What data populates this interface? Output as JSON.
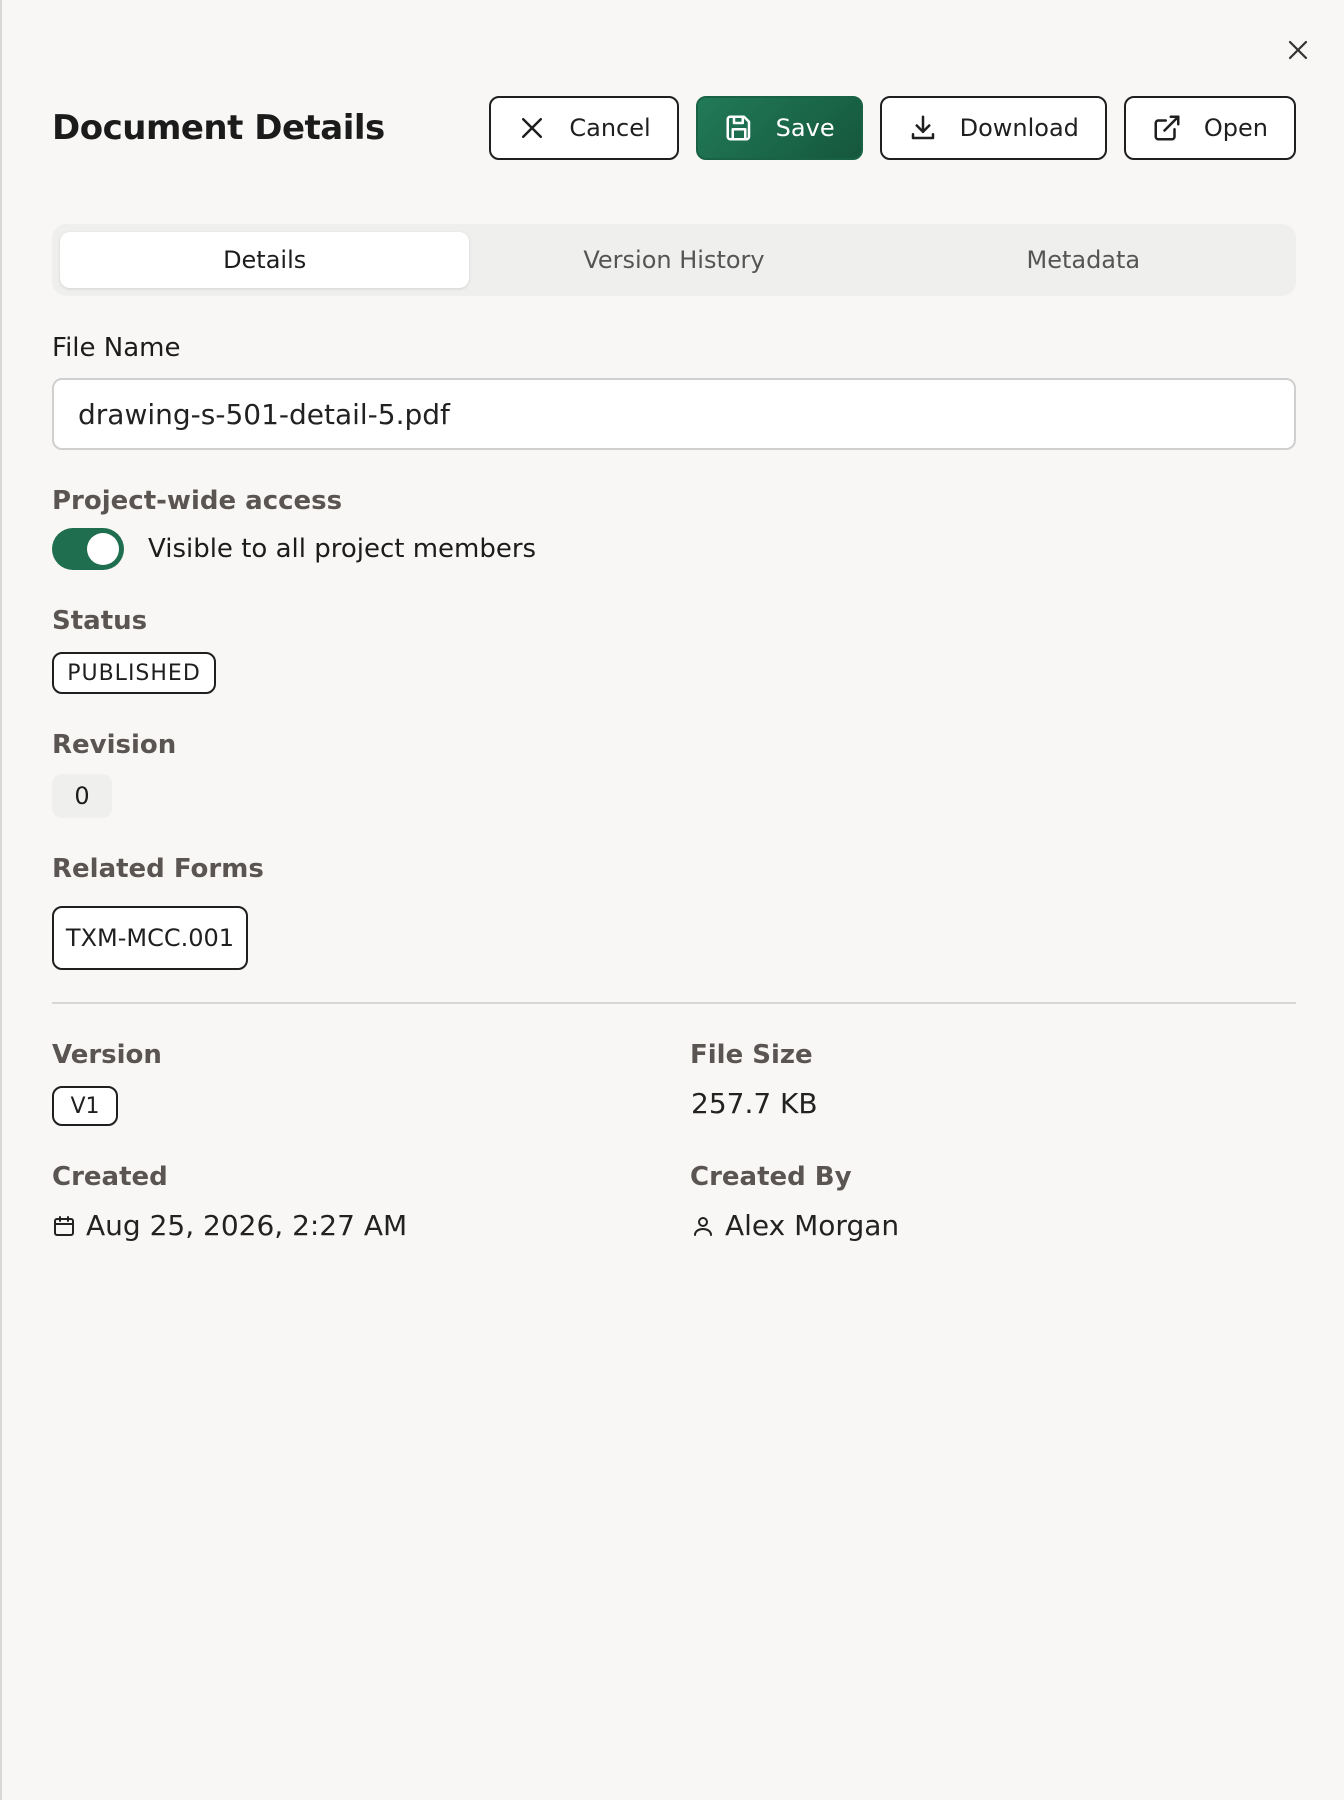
{
  "dialog": {
    "title": "Document Details",
    "actions": {
      "cancel_label": "Cancel",
      "save_label": "Save",
      "download_label": "Download",
      "open_label": "Open"
    },
    "close_icon": "close-icon"
  },
  "tabs": [
    {
      "label": "Details",
      "active": true
    },
    {
      "label": "Version History",
      "active": false
    },
    {
      "label": "Metadata",
      "active": false
    }
  ],
  "form": {
    "file_name_label": "File Name",
    "file_name_value": "drawing-s-501-detail-5.pdf",
    "access_label": "Project-wide access",
    "access_toggle_on": true,
    "access_toggle_text": "Visible to all project members",
    "status_label": "Status",
    "status_value": "PUBLISHED",
    "revision_label": "Revision",
    "revision_value": "0",
    "related_forms_label": "Related Forms",
    "related_forms": [
      "TXM-MCC.001"
    ]
  },
  "info": {
    "version_label": "Version",
    "version_value": "V1",
    "file_size_label": "File Size",
    "file_size_value": "257.7 KB",
    "created_label": "Created",
    "created_value": "Aug 25, 2026, 2:27 AM",
    "created_by_label": "Created By",
    "created_by_value": "Alex Morgan"
  },
  "colors": {
    "accent": "#1e6e4f",
    "background": "#f8f7f5"
  }
}
